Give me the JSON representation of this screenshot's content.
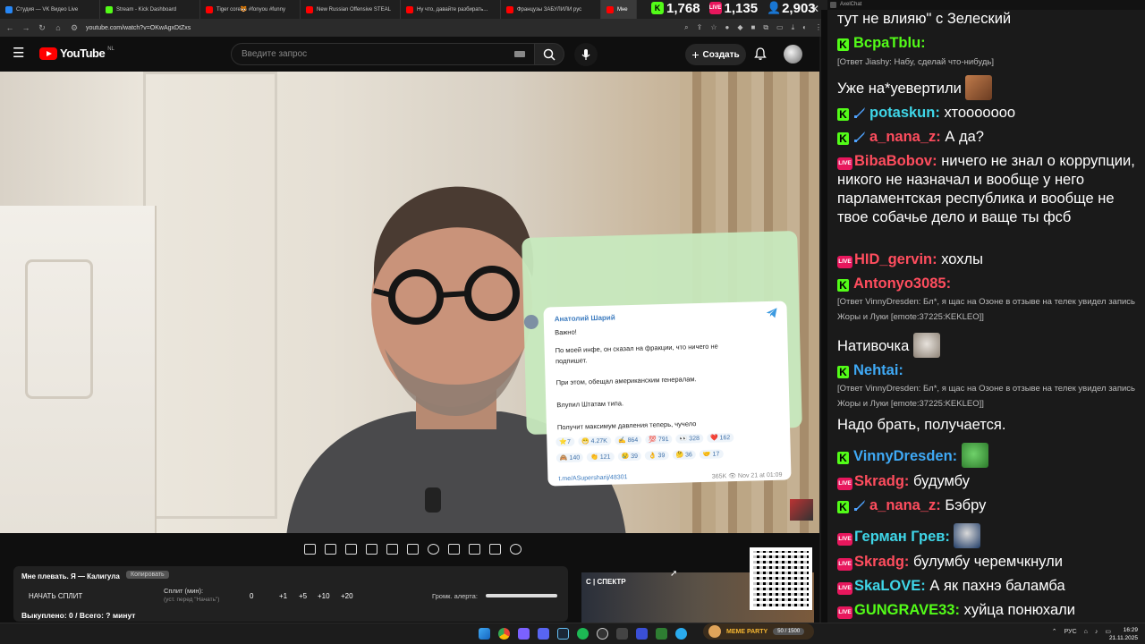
{
  "browser": {
    "tabs": [
      {
        "label": "Студия — VK Видео Live",
        "color": "#2787f5"
      },
      {
        "label": "Stream - Kick Dashboard",
        "color": "#53fc18"
      },
      {
        "label": "Tiger core🐯 #fonyou #funny",
        "color": "#ff0000"
      },
      {
        "label": "New Russian Offensive STEAL",
        "color": "#ff0000"
      },
      {
        "label": "Ну что, давайте разбирать...",
        "color": "#ff0000"
      },
      {
        "label": "Французы ЗАБУЛИЛИ рус",
        "color": "#ff0000"
      },
      {
        "label": "Мне",
        "color": "#ff0000"
      }
    ],
    "url": "youtube.com/watch?v=OKwAgxDtZxs"
  },
  "counters": {
    "kick": "1,768",
    "live": "1,135",
    "viewers": "2,903"
  },
  "youtube": {
    "logo": "YouTube",
    "region": "NL",
    "search_placeholder": "Введите запрос",
    "create_label": "Создать"
  },
  "telegram": {
    "author": "Анатолий Шарий",
    "lines": [
      "Важно!",
      "По моей инфе, он сказал на фракции, что ничего не",
      "подпишет.",
      "При этом, обещал американским генералам.",
      "Влупил Штатам типа.",
      "Получит максимум давления теперь, чучело"
    ],
    "reactions_row1": [
      "⭐7",
      "😁 4.27K",
      "✍ 864",
      "💯 791",
      "👀 328",
      "❤️ 162"
    ],
    "reactions_row2": [
      "🙈 140",
      "👏 121",
      "😢 39",
      "👌 39",
      "🤔 36",
      "🤝 17"
    ],
    "link": "t.me/ASupersharij/48301",
    "meta": "365K 👁  Nov 21 at 01:09"
  },
  "split": {
    "title": "Мне плевать. Я — Калигула",
    "badge": "Копировать",
    "start_label": "НАЧАТЬ СПЛИТ",
    "split_label": "Сплит (мин):",
    "split_sub": "(уст. перед \"Начать\")",
    "split_value": "0",
    "increments": [
      "+1",
      "+5",
      "+10",
      "+20"
    ],
    "volume_label": "Громк. алерта:",
    "bought": "Выкуплено: 0 / Всего: ? минут"
  },
  "promo": {
    "label": "С | СПЕКТР"
  },
  "chat": {
    "window_title": "AxelChat",
    "messages": [
      {
        "text": "тут не влияю\" с Зелеский"
      },
      {
        "nick": "ВсраТblu:",
        "color": "#53fc18",
        "badge": "kick"
      },
      {
        "reply": "[Ответ Jiashy: Набу, сделай что-нибудь]"
      },
      {
        "text": "Уже на*уевертили"
      },
      {
        "nick": "potaskun:",
        "color": "#3fd6e8",
        "badge": "kick-sword",
        "text": "хтоооoooo"
      },
      {
        "nick": "a_nana_z:",
        "color": "#ff4d5e",
        "badge": "kick-sword",
        "text": "А да?"
      },
      {
        "nick": "BibaBobov:",
        "color": "#ff4d5e",
        "badge": "live",
        "text": "ничего не знал о коррупции, никого не назначал и вообще у него парламентская республика и вообще не твое собачье дело и ваще ты фсб"
      },
      {
        "nick": "HID_gervin:",
        "color": "#ff4d5e",
        "badge": "live",
        "text": "хохлы"
      },
      {
        "nick": "Antonyo3085:",
        "color": "#ff4d5e",
        "badge": "kick"
      },
      {
        "reply": "[Ответ VinnyDresden: Бл*, я щас на Озоне в отзыве на телек увидел запись Жоры и Луки [emote:37225:KEKLEO]]"
      },
      {
        "text": "Нативочка"
      },
      {
        "nick": "Nehtai:",
        "color": "#3fa9f5",
        "badge": "kick"
      },
      {
        "reply": "[Ответ VinnyDresden: Бл*, я щас на Озоне в отзыве на телек увидел запись Жоры и Луки [emote:37225:KEKLEO]]"
      },
      {
        "text": "Надо брать, получается."
      },
      {
        "nick": "VinnyDresden:",
        "color": "#3fa9f5",
        "badge": "kick"
      },
      {
        "nick": "Skradg:",
        "color": "#ff4d5e",
        "badge": "live",
        "text": "будумбу"
      },
      {
        "nick": "a_nana_z:",
        "color": "#ff4d5e",
        "badge": "kick-sword",
        "text": "Бэбру"
      },
      {
        "nick": "Герман Грев:",
        "color": "#3fd6e8",
        "badge": "live"
      },
      {
        "nick": "Skradg:",
        "color": "#ff4d5e",
        "badge": "live",
        "text": "булумбу черемчкнули"
      },
      {
        "nick": "SkaLOVE:",
        "color": "#3fd6e8",
        "badge": "live",
        "text": "А як пахнэ баламба"
      },
      {
        "nick": "GUNGRAVE33:",
        "color": "#53fc18",
        "badge": "live",
        "text": "хуйца понюхали"
      }
    ]
  },
  "taskbar": {
    "meme_name": "MEME PARTY",
    "meme_count": "50 / 1500",
    "lang": "РУС",
    "time": "16:29",
    "date": "21.11.2025"
  }
}
